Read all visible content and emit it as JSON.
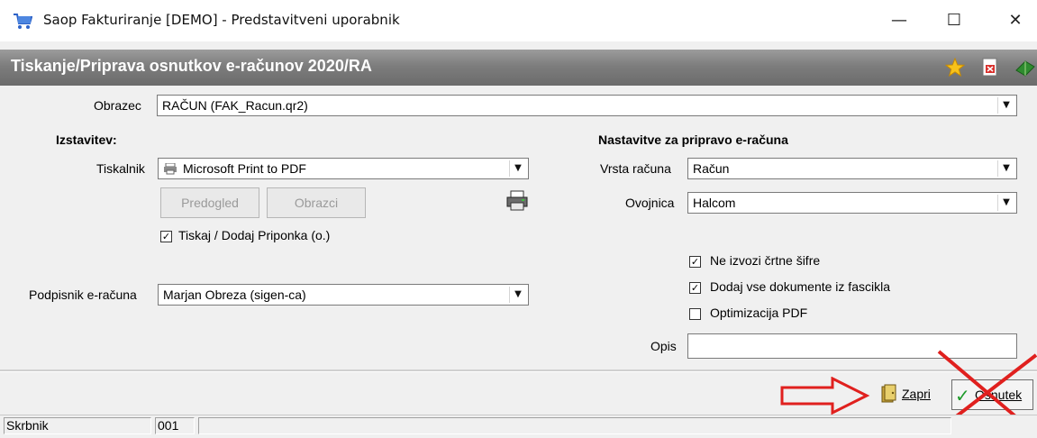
{
  "window": {
    "title": "Saop Fakturiranje [DEMO] - Predstavitveni uporabnik",
    "minimize_glyph": "—",
    "maximize_glyph": "☐",
    "close_glyph": "✕"
  },
  "header": {
    "title": "Tiskanje/Priprava osnutkov e-računov 2020/RA"
  },
  "form": {
    "obrazec_label": "Obrazec",
    "obrazec_value": "RAČUN  (FAK_Racun.qr2)",
    "izstavitev_heading": "Izstavitev:",
    "tiskalnik_label": "Tiskalnik",
    "tiskalnik_value": "Microsoft Print to PDF",
    "predogled_label": "Predogled",
    "obrazci_label": "Obrazci",
    "tiskaj_label": "Tiskaj / Dodaj Priponka (o.)",
    "tiskaj_checked": true,
    "podpisnik_label": "Podpisnik e-računa",
    "podpisnik_value": "Marjan Obreza (sigen-ca)",
    "nastavitve_heading": "Nastavitve za pripravo e-računa",
    "vrsta_label": "Vrsta računa",
    "vrsta_value": "Račun",
    "ovojnica_label": "Ovojnica",
    "ovojnica_value": "Halcom",
    "ne_izvozi_label": "Ne izvozi črtne šifre",
    "ne_izvozi_checked": true,
    "dodaj_label": "Dodaj vse dokumente iz fascikla",
    "dodaj_checked": true,
    "optimizacija_label": "Optimizacija PDF",
    "optimizacija_checked": false,
    "opis_label": "Opis",
    "opis_value": ""
  },
  "buttons": {
    "zapri_label": "Zapri",
    "osnutek_label": "Osnutek"
  },
  "status": {
    "user": "Skrbnik",
    "code": "001"
  },
  "colors": {
    "annotation_red": "#e0201e",
    "header_gray": "#7d7d7d"
  }
}
